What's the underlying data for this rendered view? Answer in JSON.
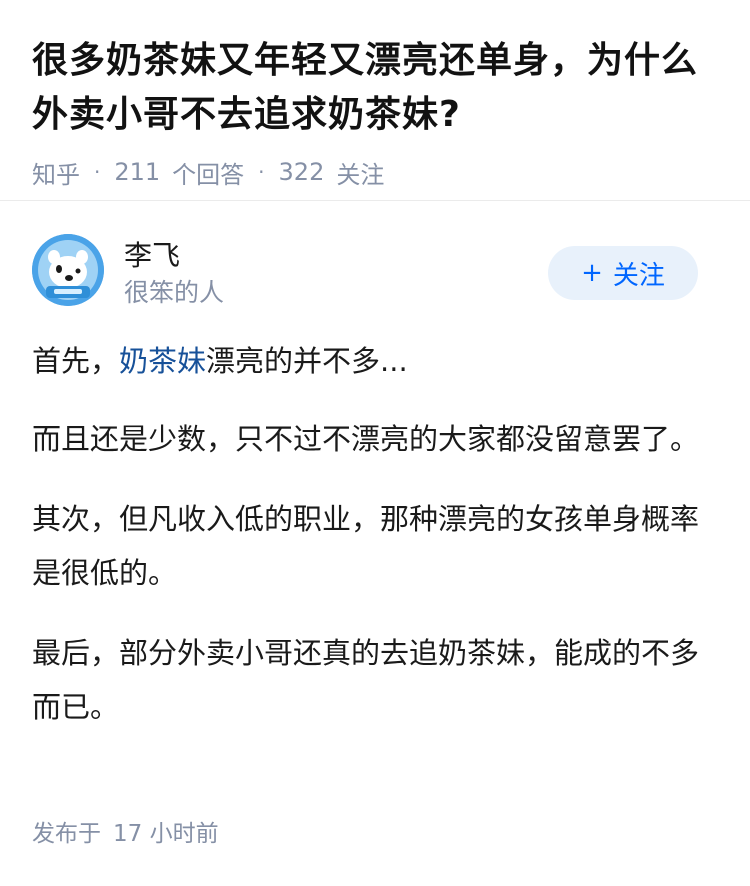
{
  "question": {
    "title": "很多奶茶妹又年轻又漂亮还单身，为什么外卖小哥不去追求奶茶妹?",
    "source": "知乎",
    "answer_count": "211",
    "answer_label": "个回答",
    "follow_count": "322",
    "follow_label": "关注",
    "separator": "·"
  },
  "author": {
    "name": "李飞",
    "bio": "很笨的人",
    "follow_button_label": "关注",
    "follow_button_icon": "plus-icon"
  },
  "answer": {
    "p1_prefix": "首先，",
    "p1_link": "奶茶妹",
    "p1_suffix": "漂亮的并不多...",
    "p2": "而且还是少数，只不过不漂亮的大家都没留意罢了。",
    "p3": "其次，但凡收入低的职业，那种漂亮的女孩单身概率是很低的。",
    "p4": "最后，部分外卖小哥还真的去追奶茶妹，能成的不多而已。"
  },
  "footer": {
    "published_label": "发布于",
    "published_time": "17 小时前"
  },
  "colors": {
    "link": "#175199",
    "meta": "#8590a6",
    "follow_bg": "#e8f1fb",
    "follow_text": "#0066ff"
  }
}
